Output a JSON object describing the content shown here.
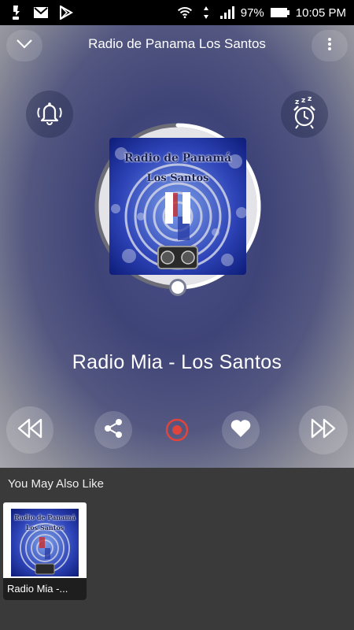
{
  "status_bar": {
    "battery_percent": "97%",
    "time": "10:05 PM",
    "left_icons": [
      "notification-icon",
      "gmail-icon",
      "play-store-icon"
    ],
    "right_icons": [
      "wifi-icon",
      "signal-icon",
      "battery-icon"
    ]
  },
  "header": {
    "title": "Radio de Panama Los Santos",
    "collapse_icon": "chevron-down-icon",
    "menu_icon": "more-vert-icon"
  },
  "actions": {
    "alarm_icon": "bell-icon",
    "sleep_timer_icon": "alarm-clock-zzz-icon"
  },
  "artwork": {
    "line1": "Radio de Panamá",
    "line2": "Los Santos",
    "state_icon": "pause-icon"
  },
  "progress": {
    "fraction": 0.5
  },
  "now_playing": {
    "station_name": "Radio Mia - Los Santos"
  },
  "controls": {
    "prev_icon": "rewind-icon",
    "share_icon": "share-icon",
    "record_icon": "record-icon",
    "favorite_icon": "heart-icon",
    "next_icon": "fast-forward-icon"
  },
  "suggestions": {
    "heading": "You May Also Like",
    "items": [
      {
        "label": "Radio Mia -...",
        "art_line1": "Radio de Panamá",
        "art_line2": "Los Santos"
      }
    ]
  },
  "colors": {
    "accent_record": "#e0453d",
    "player_bg": "#4a4f86",
    "bottom_bg": "#3a3a3a"
  }
}
